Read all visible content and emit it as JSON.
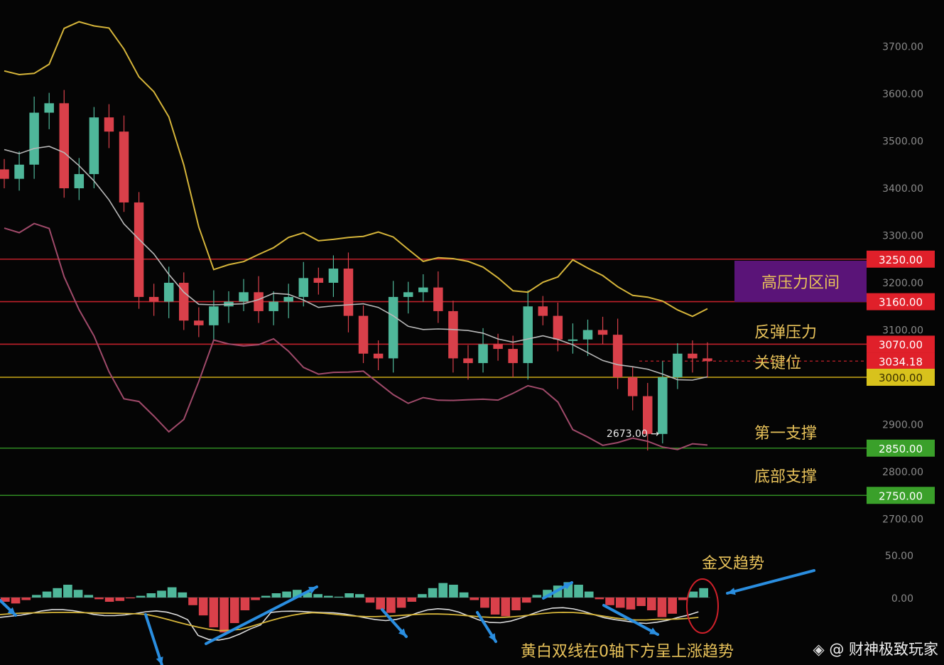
{
  "chart_data": [
    {
      "type": "candlestick",
      "title": "",
      "ylim": [
        2680,
        3750
      ],
      "y_ticks": [
        "3700.00",
        "3600.00",
        "3500.00",
        "3400.00",
        "3300.00",
        "3200.00",
        "3100.00",
        "3000.00",
        "2900.00",
        "2800.00",
        "2700.00"
      ],
      "close_approx": [
        3420,
        3450,
        3560,
        3580,
        3400,
        3430,
        3550,
        3520,
        3370,
        3170,
        3160,
        3200,
        3120,
        3110,
        3150,
        3160,
        3180,
        3140,
        3160,
        3170,
        3210,
        3200,
        3230,
        3130,
        3050,
        3040,
        3170,
        3180,
        3190,
        3140,
        3040,
        3030,
        3070,
        3060,
        3030,
        3150,
        3130,
        3080,
        3080,
        3100,
        3090,
        3000,
        2960,
        2880,
        3000,
        3050,
        3040,
        3034.18
      ],
      "lines": {
        "resistance_high": 3250.0,
        "resistance_low": 3160.0,
        "rebound_pressure": 3070.0,
        "last_price": 3034.18,
        "key_level": 3000.0,
        "support_1": 2850.0,
        "support_bottom": 2750.0
      },
      "price_tags": [
        {
          "label": "3250.00",
          "color": "#e0202a"
        },
        {
          "label": "3160.00",
          "color": "#e0202a"
        },
        {
          "label": "3070.00",
          "color": "#e0202a"
        },
        {
          "label": "3034.18",
          "color": "#e0202a"
        },
        {
          "label": "3000.00",
          "color": "#d8c21c"
        },
        {
          "label": "2850.00",
          "color": "#3aa02a"
        },
        {
          "label": "2750.00",
          "color": "#3aa02a"
        }
      ],
      "low_marker": {
        "value": 2673.0,
        "label": "2673.00"
      },
      "annotations": {
        "high_pressure_zone": "高压力区间",
        "rebound_pressure": "反弹压力",
        "key_level": "关键位",
        "first_support": "第一支撑",
        "bottom_support": "底部支撑"
      }
    },
    {
      "type": "macd",
      "y_ticks": [
        "50.00",
        "0.00"
      ],
      "annotations": {
        "golden_cross": "金叉趋势",
        "lines_rising": "黄白双线在0轴下方呈上涨趋势"
      }
    }
  ],
  "colors": {
    "background": "#050505",
    "up": "#4fb79a",
    "down": "#d9404a",
    "upper_band": "#d6b53a",
    "mid_band": "#b8b8b8",
    "lower_band": "#a04a6a",
    "annotation_text": "#e8c25a",
    "zone_box": "#5a1478",
    "arrow": "#2a8ee0"
  },
  "watermark": "@ 财神极致玩家",
  "watermark_icon": "binance-diamond-icon"
}
